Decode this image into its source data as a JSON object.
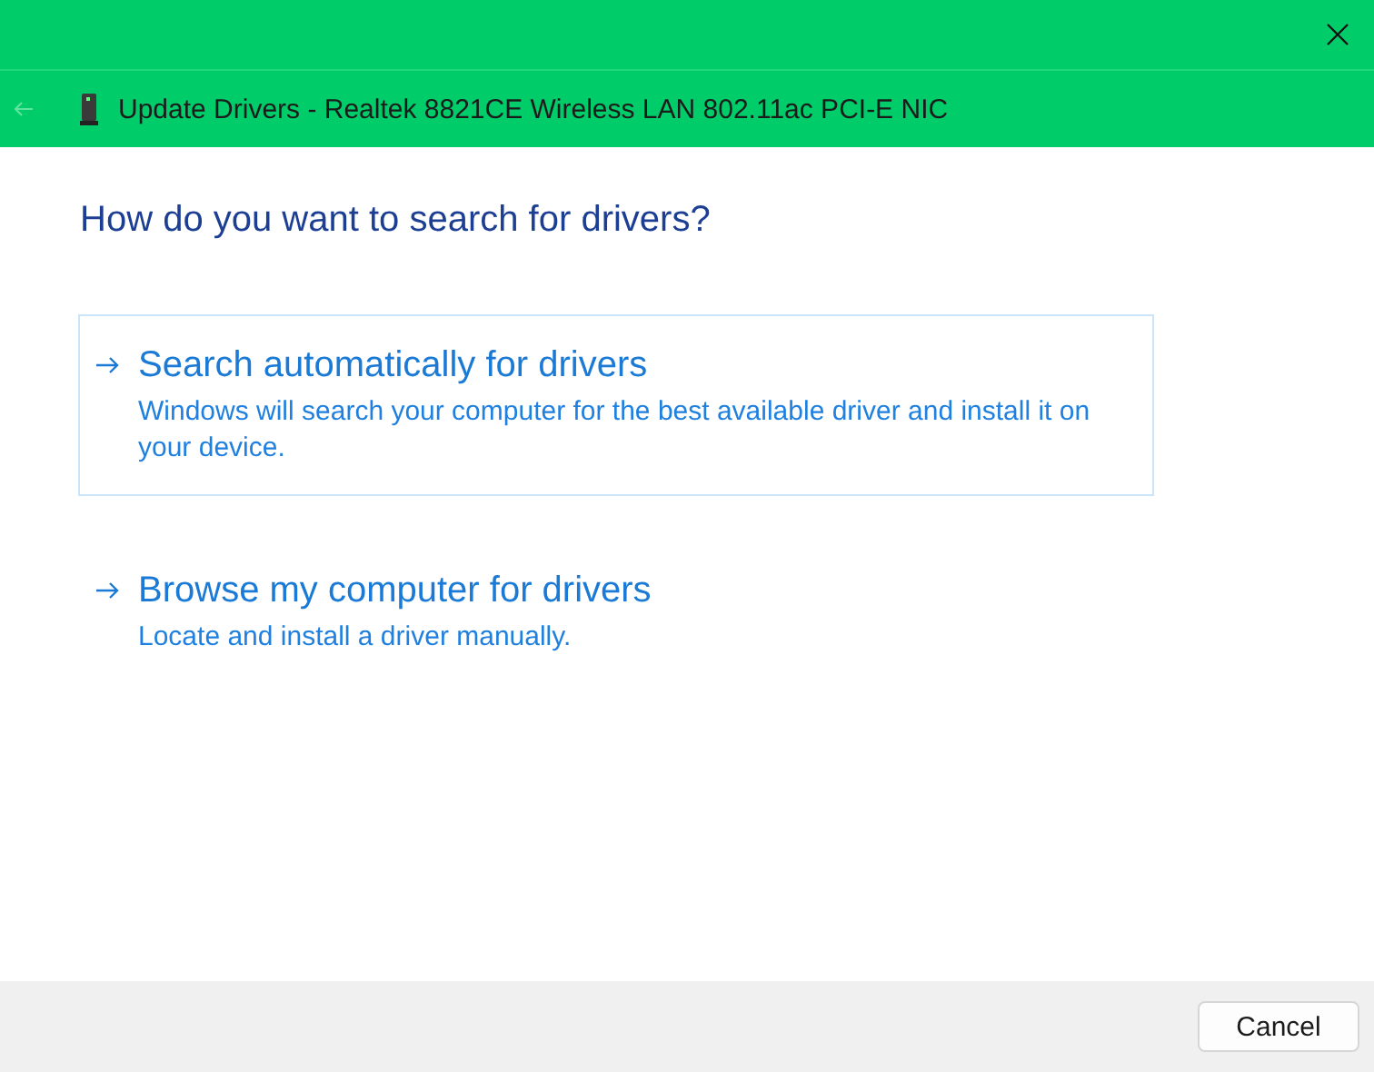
{
  "window": {
    "title": "Update Drivers - Realtek 8821CE Wireless LAN 802.11ac PCI-E NIC"
  },
  "heading": "How do you want to search for drivers?",
  "options": [
    {
      "title": "Search automatically for drivers",
      "description": "Windows will search your computer for the best available driver and install it on your device.",
      "selected": true
    },
    {
      "title": "Browse my computer for drivers",
      "description": "Locate and install a driver manually.",
      "selected": false
    }
  ],
  "buttons": [
    "Cancel"
  ]
}
